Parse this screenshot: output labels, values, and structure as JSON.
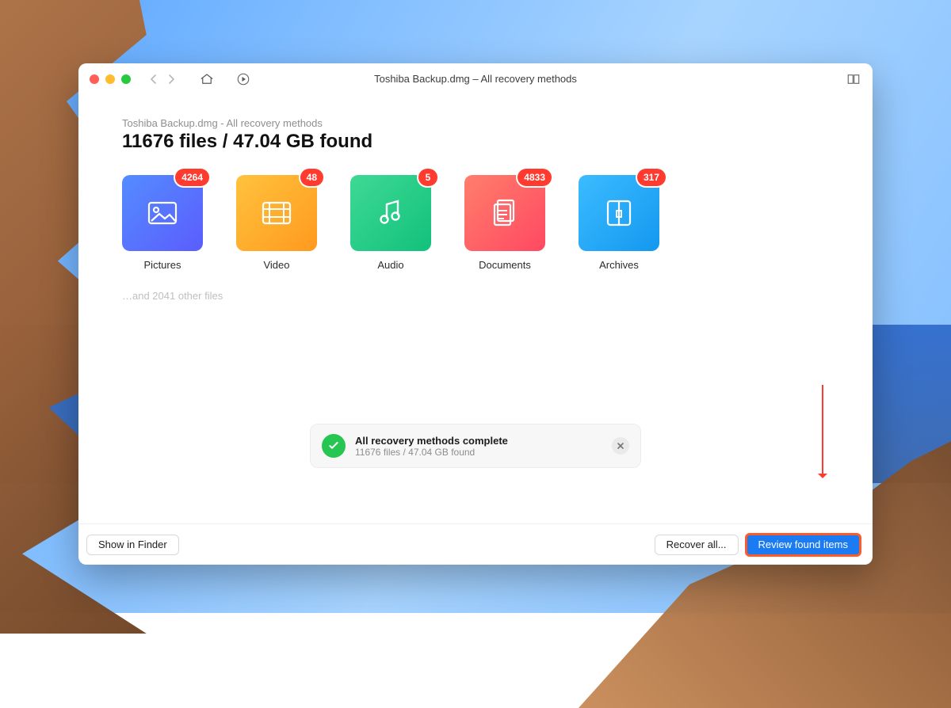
{
  "titlebar": {
    "title": "Toshiba Backup.dmg – All recovery methods"
  },
  "breadcrumb": "Toshiba Backup.dmg - All recovery methods",
  "headline": "11676 files / 47.04 GB found",
  "categories": [
    {
      "id": "pictures",
      "label": "Pictures",
      "count": "4264",
      "tile": "tile-pictures"
    },
    {
      "id": "video",
      "label": "Video",
      "count": "48",
      "tile": "tile-video"
    },
    {
      "id": "audio",
      "label": "Audio",
      "count": "5",
      "tile": "tile-audio"
    },
    {
      "id": "documents",
      "label": "Documents",
      "count": "4833",
      "tile": "tile-documents"
    },
    {
      "id": "archives",
      "label": "Archives",
      "count": "317",
      "tile": "tile-archives"
    }
  ],
  "other_files": "…and 2041 other files",
  "status": {
    "title": "All recovery methods complete",
    "subtitle": "11676 files / 47.04 GB found"
  },
  "footer": {
    "show_in_finder": "Show in Finder",
    "recover_all": "Recover all...",
    "review": "Review found items"
  }
}
